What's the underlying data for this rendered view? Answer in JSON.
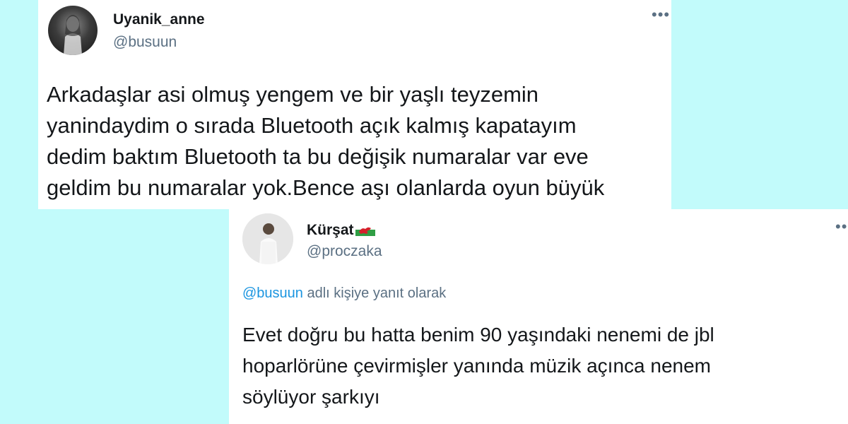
{
  "tweets": [
    {
      "display_name": "Uyanik_anne",
      "handle": "@busuun",
      "more_icon": "more-horizontal-icon",
      "avatar_icon": "avatar-photo",
      "text": "Arkadaşlar asi olmuş yengem ve bir yaşlı teyzemin\nyanindaydim o sırada Bluetooth açık kalmış kapatayım\ndedim baktım Bluetooth ta bu değişik numaralar var eve\ngeldim bu numaralar yok.Bence aşı olanlarda oyun büyük"
    },
    {
      "display_name": "Kürşat",
      "flag_icon": "wales-flag-icon",
      "handle": "@proczaka",
      "more_icon": "more-horizontal-icon",
      "avatar_icon": "avatar-photo",
      "reply_to_mention": "@busuun",
      "reply_to_text": " adlı kişiye yanıt olarak",
      "text": "Evet doğru bu hatta benim 90 yaşındaki nenemi de jbl\nhoparlörüne çevirmişler yanında müzik açınca nenem\nsöylüyor şarkıyı"
    }
  ],
  "colors": {
    "page_background": "#c2fbfb",
    "card_background": "#ffffff",
    "primary_text": "#14171a",
    "secondary_text": "#5b7083",
    "link": "#1b95e0"
  }
}
